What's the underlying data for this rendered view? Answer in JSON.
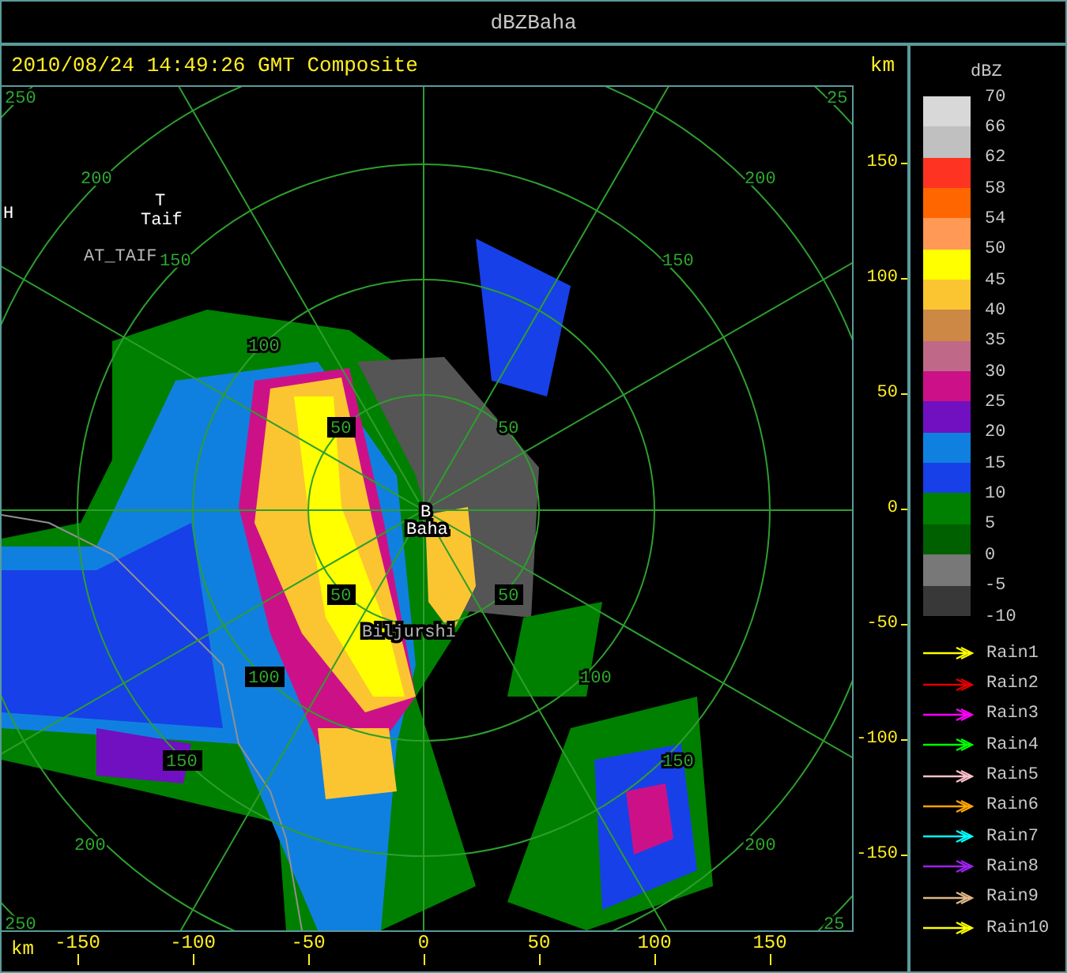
{
  "window": {
    "title": "dBZBaha"
  },
  "header": {
    "timestamp": "2010/08/24 14:49:26 GMT Composite",
    "unit": "km"
  },
  "map": {
    "range_labels": [
      {
        "text": "250",
        "boxed": false
      },
      {
        "text": "25",
        "boxed": false
      },
      {
        "text": "200",
        "boxed": false
      },
      {
        "text": "200",
        "boxed": false
      },
      {
        "text": "150",
        "boxed": false
      },
      {
        "text": "150",
        "boxed": false
      },
      {
        "text": "100",
        "boxed": false
      },
      {
        "text": "50",
        "boxed": true
      },
      {
        "text": "50",
        "boxed": false
      },
      {
        "text": "50",
        "boxed": true
      },
      {
        "text": "50",
        "boxed": true
      },
      {
        "text": "100",
        "boxed": true
      },
      {
        "text": "100",
        "boxed": false
      },
      {
        "text": "150",
        "boxed": true
      },
      {
        "text": "150",
        "boxed": false
      },
      {
        "text": "200",
        "boxed": false
      },
      {
        "text": "200",
        "boxed": false
      },
      {
        "text": "250",
        "boxed": false
      },
      {
        "text": "25",
        "boxed": false
      }
    ],
    "places": [
      {
        "text": "H",
        "kind": "city"
      },
      {
        "text": "T",
        "kind": "city"
      },
      {
        "text": "Taif",
        "kind": "city"
      },
      {
        "text": "AT_TAIF",
        "kind": "station"
      },
      {
        "text": "B",
        "kind": "city"
      },
      {
        "text": "Baha",
        "kind": "city"
      },
      {
        "text": "Biljurshi",
        "kind": "station"
      }
    ]
  },
  "y_axis": {
    "labels": [
      "150",
      "100",
      "50",
      "0",
      "-50",
      "-100",
      "-150"
    ]
  },
  "x_axis": {
    "unit": "km",
    "labels": [
      "-150",
      "-100",
      "-50",
      "0",
      "50",
      "100",
      "150"
    ]
  },
  "legend": {
    "title": "dBZ",
    "scale_labels": [
      "70",
      "66",
      "62",
      "58",
      "54",
      "50",
      "45",
      "40",
      "35",
      "30",
      "25",
      "20",
      "15",
      "10",
      "5",
      "0",
      "-5",
      "-10"
    ],
    "bands": [
      {
        "color": "#d8d8d8"
      },
      {
        "color": "#c0c0c0"
      },
      {
        "color": "#ff3322"
      },
      {
        "color": "#ff6600"
      },
      {
        "color": "#ff9955"
      },
      {
        "color": "#ffff00"
      },
      {
        "color": "#fbc531"
      },
      {
        "color": "#cc8844"
      },
      {
        "color": "#c06888"
      },
      {
        "color": "#cc1188"
      },
      {
        "color": "#7010c0"
      },
      {
        "color": "#1080e0"
      },
      {
        "color": "#1840e8"
      },
      {
        "color": "#008000"
      },
      {
        "color": "#006000"
      },
      {
        "color": "#787878"
      },
      {
        "color": "#383838"
      }
    ],
    "tracks": [
      {
        "label": "Rain1",
        "color": "#ffff00"
      },
      {
        "label": "Rain2",
        "color": "#e00000"
      },
      {
        "label": "Rain3",
        "color": "#ff00ff"
      },
      {
        "label": "Rain4",
        "color": "#00ff00"
      },
      {
        "label": "Rain5",
        "color": "#ffc0cb"
      },
      {
        "label": "Rain6",
        "color": "#ffa500"
      },
      {
        "label": "Rain7",
        "color": "#00ffff"
      },
      {
        "label": "Rain8",
        "color": "#a020f0"
      },
      {
        "label": "Rain9",
        "color": "#deb887"
      },
      {
        "label": "Rain10",
        "color": "#ffff00"
      }
    ]
  }
}
